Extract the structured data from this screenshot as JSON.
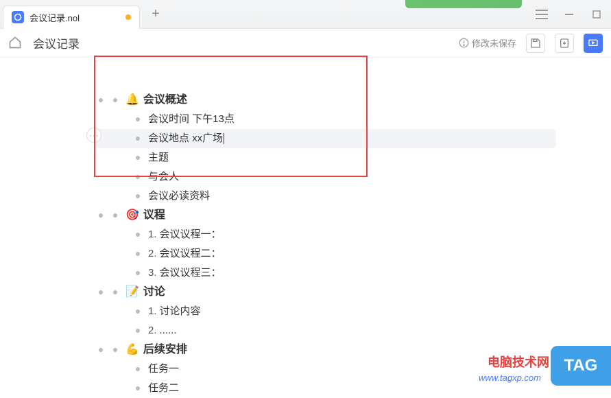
{
  "tab": {
    "title": "会议记录.nol",
    "modified": true
  },
  "toolbar": {
    "doc_title": "会议记录",
    "unsaved_label": "修改未保存"
  },
  "outline": {
    "s1": {
      "title": "会议概述",
      "items": [
        "会议时间 下午13点",
        "会议地点  xx广场",
        "主题",
        "与会人",
        "会议必读资料"
      ]
    },
    "s2": {
      "title": "议程",
      "items": [
        {
          "num": "1.",
          "text": "会议议程一："
        },
        {
          "num": "2.",
          "text": "会议议程二："
        },
        {
          "num": "3.",
          "text": "会议议程三："
        }
      ]
    },
    "s3": {
      "title": "讨论",
      "items": [
        {
          "num": "1.",
          "text": "讨论内容"
        },
        {
          "num": "2.",
          "text": "......"
        }
      ]
    },
    "s4": {
      "title": "后续安排",
      "items": [
        "任务一",
        "任务二"
      ]
    }
  },
  "watermark": {
    "text": "电脑技术网",
    "url": "www.tagxp.com",
    "badge": "TAG"
  }
}
